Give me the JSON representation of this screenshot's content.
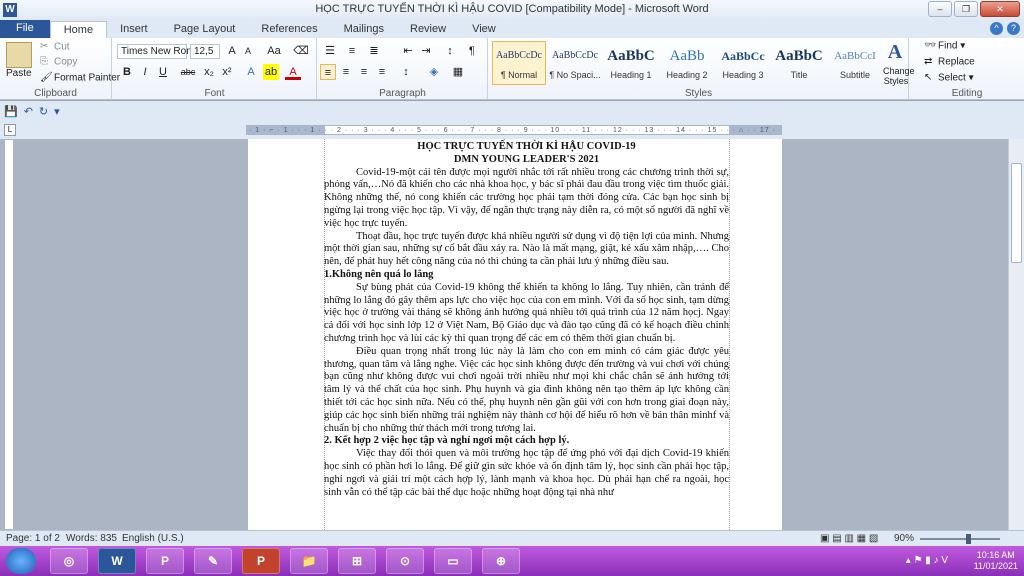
{
  "window": {
    "title": "HỌC TRỰC TUYẾN THỜI KÌ HẬU COVID [Compatibility Mode]  -  Microsoft Word",
    "app_icon": "W",
    "minimize": "–",
    "maximize": "❐",
    "close": "✕"
  },
  "tabs": [
    "File",
    "Home",
    "Insert",
    "Page Layout",
    "References",
    "Mailings",
    "Review",
    "View"
  ],
  "active_tab": "Home",
  "clipboard": {
    "paste": "Paste",
    "cut": "Cut",
    "copy": "Copy",
    "format_painter": "Format Painter",
    "label": "Clipboard"
  },
  "font": {
    "name": "Times New Rom",
    "size": "12,5",
    "grow": "A",
    "shrink": "A",
    "change_case": "Aa",
    "bold": "B",
    "italic": "I",
    "underline": "U",
    "strike": "abc",
    "subscript": "x₂",
    "superscript": "x²",
    "label": "Font"
  },
  "paragraph": {
    "label": "Paragraph"
  },
  "styles": {
    "items": [
      {
        "sample": "AaBbCcDc",
        "name": "¶ Normal"
      },
      {
        "sample": "AaBbCcDc",
        "name": "¶ No Spaci..."
      },
      {
        "sample": "AaBbC",
        "name": "Heading 1"
      },
      {
        "sample": "AaBb",
        "name": "Heading 2"
      },
      {
        "sample": "AaBbCc",
        "name": "Heading 3"
      },
      {
        "sample": "AaBbC",
        "name": "Title"
      },
      {
        "sample": "AaBbCcI",
        "name": "Subtitle"
      }
    ],
    "change_styles": "Change Styles",
    "label": "Styles"
  },
  "editing": {
    "find": "Find",
    "replace": "Replace",
    "select": "Select",
    "label": "Editing"
  },
  "ruler": {
    "numbers": "· 1 · ⌐ · 1 · · · 1 · · · 2 · · · 3 · · · 4 · · · 5 · · · 6 · · · 7 · · · 8 · · · 9 · · · 10 · · · 11 · · · 12 · · · 13 · · · 14 · · · 15 · · · ⌂ · · 17 ·"
  },
  "document": {
    "title": "HỌC TRỰC TUYẾN THỜI KÌ HẬU COVID-19",
    "subtitle": "DMN YOUNG LEADER'S 2021",
    "p1": "Covid-19-một cái tên được mọi người nhắc tới rất nhiều trong các chương trình thời sự, phỏng vấn,…Nó đã khiến cho các nhà khoa học, y bác sĩ phải đau đầu trong việc tìm thuốc giải. Không những thế, nó cong khiến các trường học phải tạm thời đóng cửa. Các bạn học sinh bị ngừng lại trong việc học tập. Vì vậy, để ngăn thực trạng này diễn ra, có một số người đã nghĩ về việc học trực tuyến.",
    "p2": "Thoạt đầu, học trực tuyến được khá nhiều người sử dụng vì độ tiện lợi của mình. Nhưng một thời gian sau, những sự cố bắt đầu xảy ra. Nào là mất mạng, giật, kẻ xấu xâm nhập,…. Cho nên, để phát huy hết công năng của nó thì chúng ta cần phải lưu ý những điều sau.",
    "h1": "1.Không nên quá lo lắng",
    "p3": "Sự bùng phát của Covid-19 không thể khiến ta không lo lắng. Tuy nhiên, cần tránh để những lo lắng đó gây thêm aps lực cho việc học của con em mình. Với đa số học sinh, tạm dừng việc học ở trường vài tháng sẽ không ảnh hưởng quá nhiều tới quá trình của 12 năm họcj. Ngay cả đối với học sinh lớp 12 ở Việt Nam, Bộ Giáo dục và đào tạo cũng đã có kế hoạch điều chỉnh chương trình học và lùi các kỳ thi quan trọng để các em có thêm thời gian chuẩn bị.",
    "p4": "Điều quan trọng nhất trong lúc này là làm cho con em mình có cảm giác được yêu thương, quan tâm và lắng nghe. Việc các học sinh không được đến trường và vui chơi với chúng bạn cũng như không được vui chơi ngoài trời nhiều như mọi khi chắc chắn sẽ ảnh hưởng tới tâm lý và thể chất của học sinh. Phụ huynh và gia đình không nên tạo thêm áp lực không cần thiết tới các học sinh nữa. Nếu có thể, phụ huynh nên gần gũi với con hơn trong giai đoạn này, giúp các học sinh biến những trải nghiệm này thành cơ hội để hiểu rõ hơn về bản thân minhf và chuẩn bị cho những thử thách mới trong tương lai.",
    "h2": "2. Kết hợp 2 việc học tập và nghỉ ngơi một cách hợp lý.",
    "p5": "Việc thay đổi thói quen và môi trường học tập để ứng phó với đại dịch Covid-19 khiến học sinh có phần hơi lo lắng. Để giữ gìn sức khỏe và ổn định tâm lý, học sinh cần phải học tập, nghỉ ngơi và giải trí một cách hợp lý, lành mạnh và khoa học. Dù phải hạn chế ra ngoài, học sinh vẫn có thể tập các bài thể dục hoặc những hoạt động tại nhà như"
  },
  "status": {
    "page": "Page: 1 of 2",
    "words": "Words: 835",
    "language": "English (U.S.)",
    "zoom": "90%",
    "zoom_level": 0.55
  },
  "taskbar": {
    "time": "10:16 AM",
    "date": "11/01/2021",
    "apps": [
      "W",
      "P",
      "📁",
      "⊞",
      "⊙",
      "⊕"
    ]
  }
}
